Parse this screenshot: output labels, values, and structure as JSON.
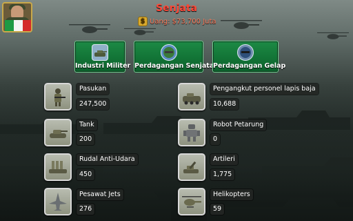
{
  "header": {
    "title": "Senjata",
    "money_label": "Uang: $73,700 Juta",
    "money_icon": "dollar-icon"
  },
  "player": {
    "flag": "italy-flag",
    "avatar": "commander-avatar"
  },
  "categories": [
    {
      "label": "Industri Militer",
      "icon": "tank-icon"
    },
    {
      "label": "Perdagangan Senjata",
      "icon": "weapon-globe-icon"
    },
    {
      "label": "Perdagangan Gelap",
      "icon": "black-market-globe-icon"
    }
  ],
  "units": [
    {
      "name": "Pasukan",
      "count": "247,500",
      "icon": "soldier-icon"
    },
    {
      "name": "Pengangkut personel lapis baja",
      "count": "10,688",
      "icon": "apc-icon"
    },
    {
      "name": "Tank",
      "count": "200",
      "icon": "tank-icon"
    },
    {
      "name": "Robot Petarung",
      "count": "0",
      "icon": "robot-icon"
    },
    {
      "name": "Rudal Anti-Udara",
      "count": "450",
      "icon": "missile-launcher-icon"
    },
    {
      "name": "Artileri",
      "count": "1,775",
      "icon": "artillery-icon"
    },
    {
      "name": "Pesawat Jets",
      "count": "276",
      "icon": "jet-icon"
    },
    {
      "name": "Helikopters",
      "count": "59",
      "icon": "helicopter-icon"
    }
  ],
  "colors": {
    "title": "#ff4a3a",
    "money": "#ff7a5a",
    "button_green": "#127436",
    "coin": "#d9a92c"
  }
}
